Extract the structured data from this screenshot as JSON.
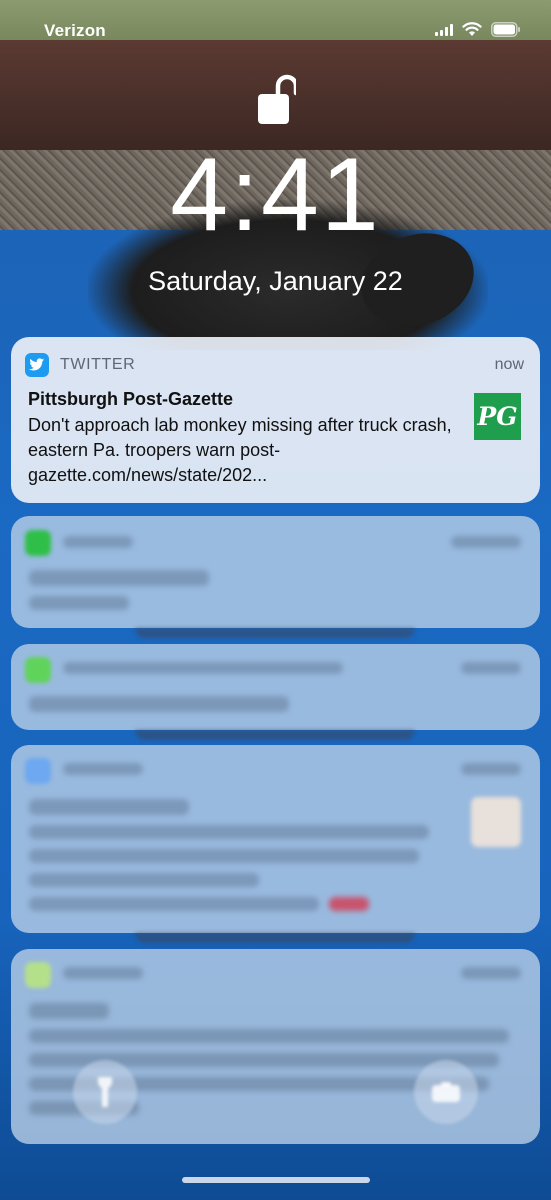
{
  "status_bar": {
    "carrier": "Verizon",
    "icons": [
      "signal-icon",
      "wifi-icon",
      "battery-icon"
    ]
  },
  "lock_screen": {
    "lock_icon": "unlocked-padlock-icon",
    "time": "4:41",
    "date": "Saturday, January 22"
  },
  "notifications": [
    {
      "app": "TWITTER",
      "app_icon": "twitter-bird-icon",
      "time": "now",
      "title": "Pittsburgh Post-Gazette",
      "body": "Don't approach lab monkey missing after truck crash, eastern Pa. troopers warn post-gazette.com/news/state/202...",
      "thumbnail_text": "PG",
      "thumbnail_color": "#1f9e4d"
    }
  ],
  "colors": {
    "twitter_blue": "#1d9bf0",
    "pool_blue": "#1a69c2",
    "notification_bg": "#e8eef6"
  },
  "bottom_controls": [
    "flashlight-icon",
    "camera-icon"
  ]
}
